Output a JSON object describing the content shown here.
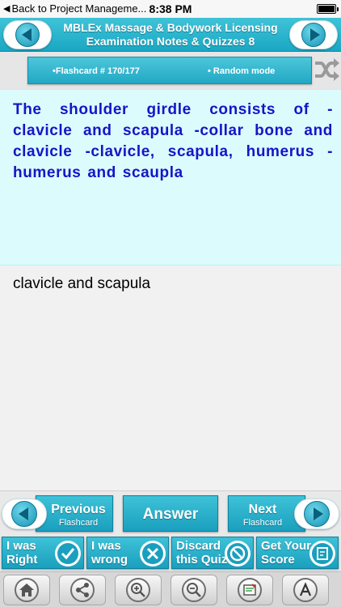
{
  "status_bar": {
    "back_label": "Back to Project Manageme...",
    "time": "8:38 PM",
    "battery_level": 1.0
  },
  "header": {
    "title_line1": "MBLEx Massage & Bodywork Licensing",
    "title_line2": "Examination Notes & Quizzes 8",
    "prev_icon": "left-arrow-icon",
    "next_icon": "right-arrow-icon"
  },
  "info_bar": {
    "flashcard_label": "•Flashcard #  170/177",
    "mode_label": "• Random mode",
    "shuffle_icon": "shuffle-icon"
  },
  "question": {
    "text": "The shoulder girdle consists of      -clavicle and scapula -collar bone and clavicle -clavicle, scapula, humerus -humerus and scaupla"
  },
  "answer": {
    "text": "clavicle and scapula"
  },
  "controls": {
    "previous_label": "Previous",
    "previous_sub": "Flashcard",
    "answer_label": "Answer",
    "next_label": "Next",
    "next_sub": "Flashcard"
  },
  "score_buttons": {
    "right_line1": "I was",
    "right_line2": "Right",
    "wrong_line1": "I was",
    "wrong_line2": "wrong",
    "discard_line1": "Discard",
    "discard_line2": "this Quiz",
    "score_line1": "Get Your",
    "score_line2": "Score"
  },
  "toolbar": {
    "icons": [
      "home-icon",
      "share-icon",
      "zoom-in-icon",
      "zoom-out-icon",
      "notes-icon",
      "font-icon"
    ]
  },
  "colors": {
    "accent": "#1aa7c3",
    "question_bg": "#dcfbfd",
    "question_text": "#1515c7"
  }
}
